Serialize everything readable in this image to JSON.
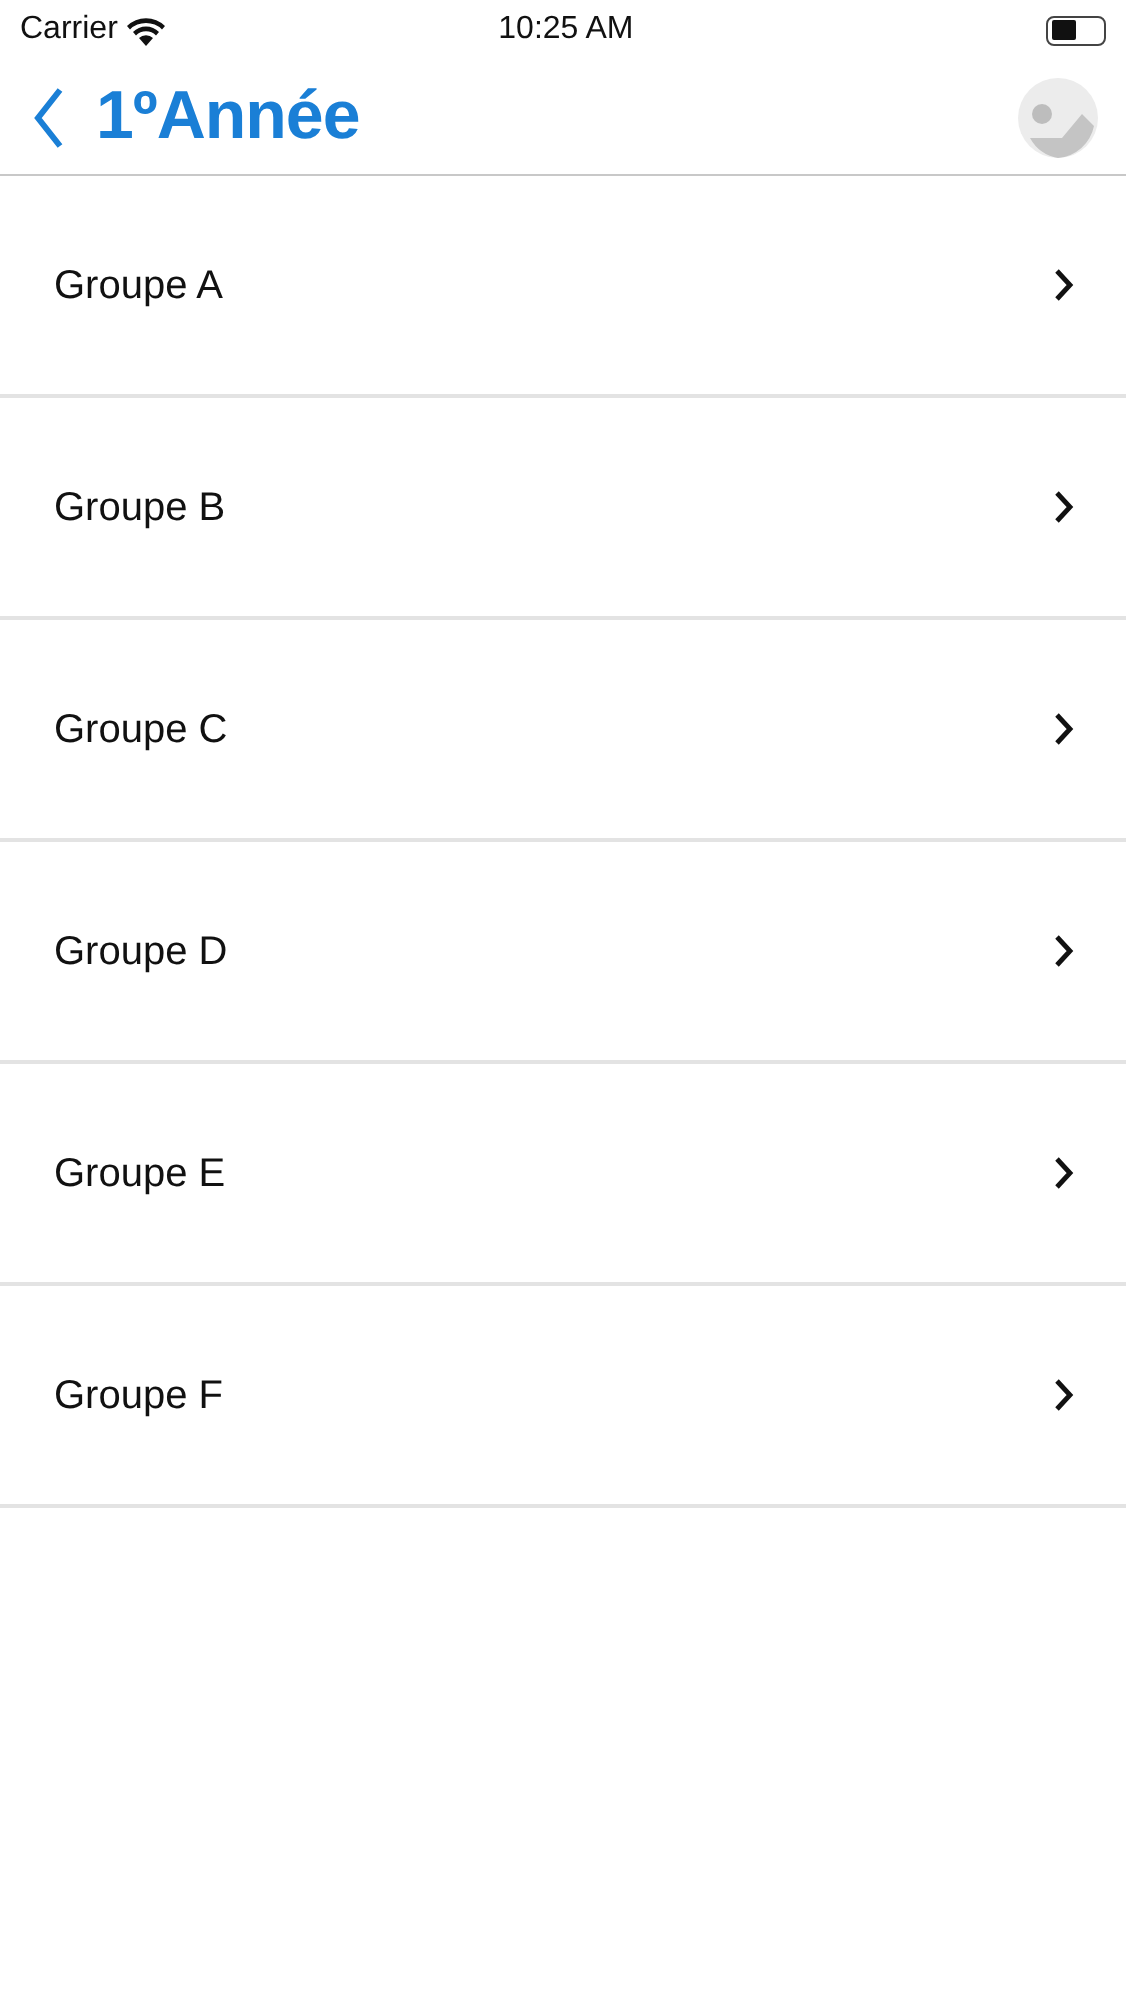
{
  "status_bar": {
    "carrier": "Carrier",
    "time": "10:25 AM"
  },
  "nav": {
    "title": "1ºAnnée"
  },
  "groups": [
    {
      "label": "Groupe A"
    },
    {
      "label": "Groupe B"
    },
    {
      "label": "Groupe C"
    },
    {
      "label": "Groupe D"
    },
    {
      "label": "Groupe E"
    },
    {
      "label": "Groupe F"
    }
  ]
}
